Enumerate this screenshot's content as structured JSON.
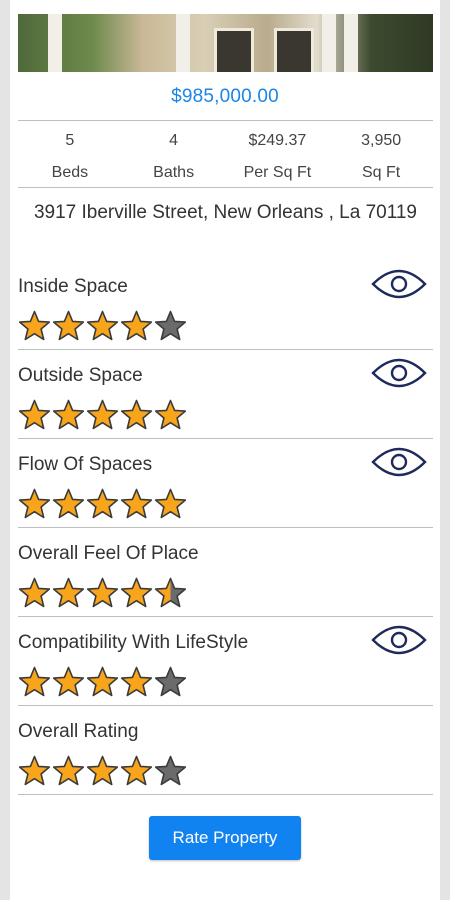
{
  "property": {
    "price": "$985,000.00",
    "stats": [
      {
        "value": "5",
        "label": "Beds"
      },
      {
        "value": "4",
        "label": "Baths"
      },
      {
        "value": "$249.37",
        "label": "Per Sq Ft"
      },
      {
        "value": "3,950",
        "label": "Sq Ft"
      }
    ],
    "address": "3917 Iberville Street, New Orleans , La 70119"
  },
  "ratings": [
    {
      "label": "Inside Space",
      "stars": 4,
      "eye": true
    },
    {
      "label": "Outside Space",
      "stars": 5,
      "eye": true
    },
    {
      "label": "Flow Of Spaces",
      "stars": 5,
      "eye": true
    },
    {
      "label": "Overall Feel Of Place",
      "stars": 4.5,
      "eye": false
    },
    {
      "label": "Compatibility With LifeStyle",
      "stars": 4,
      "eye": true
    },
    {
      "label": "Overall Rating",
      "stars": 4,
      "eye": false
    }
  ],
  "rate_button_label": "Rate Property",
  "icons": {
    "rating": "star-icon",
    "view": "eye-icon"
  },
  "colors": {
    "price": "#1b86e6",
    "button": "#1183f0",
    "star_filled": "#f8a51c",
    "star_empty": "#6b6b6b",
    "eye": "#1f2a5a"
  }
}
